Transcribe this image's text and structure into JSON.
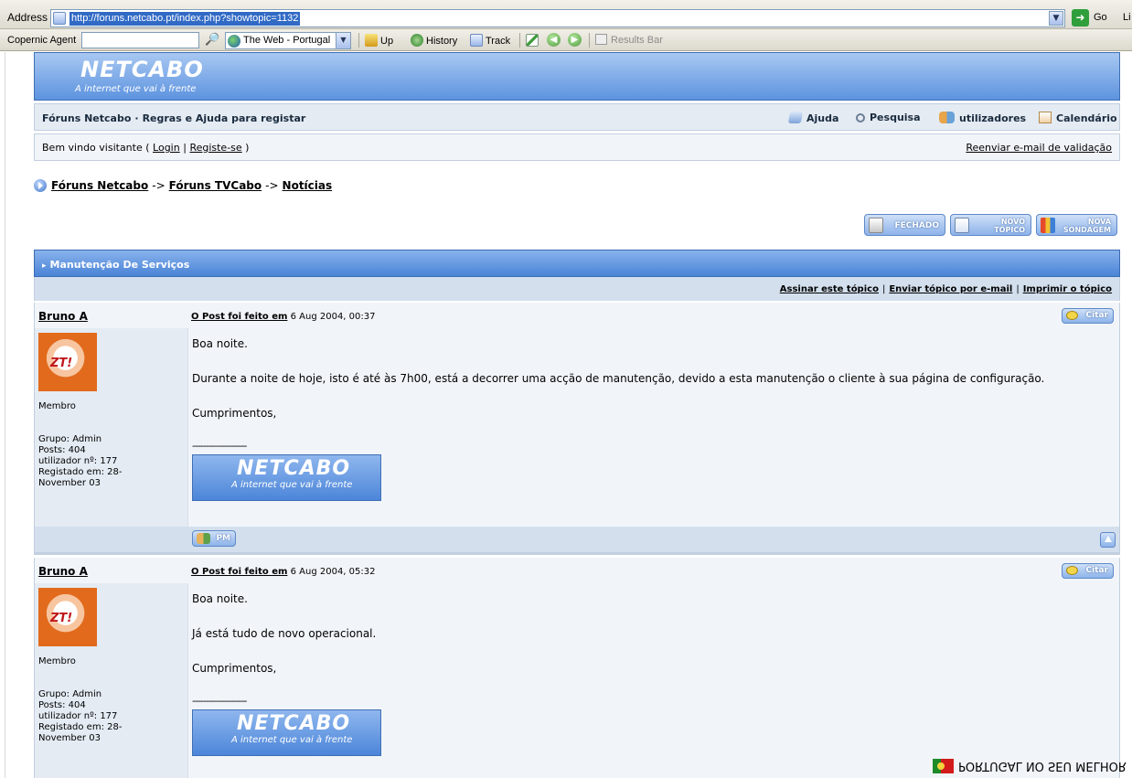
{
  "browser": {
    "address_label": "Address",
    "url": "http://foruns.netcabo.pt/index.php?showtopic=1132",
    "go_label": "Go",
    "links_label": "Li",
    "toolbar": {
      "agent_label": "Copernic Agent",
      "search_value": "",
      "search_scope": "The Web - Portugal",
      "up_label": "Up",
      "history_label": "History",
      "track_label": "Track",
      "results_bar_label": "Results Bar"
    }
  },
  "banner": {
    "logo": "NETCABO",
    "tagline": "A internet que vai à frente"
  },
  "nav": {
    "forum_name": "Fóruns Netcabo",
    "separator": "·",
    "rules": "Regras e Ajuda para registar",
    "help": "Ajuda",
    "search": "Pesquisa",
    "users": "utilizadores",
    "calendar": "Calendário"
  },
  "welcome": {
    "prefix": "Bem vindo visitante (",
    "login": "Login",
    "pipe": "|",
    "register": "Registe-se",
    "suffix": ")",
    "resend": "Reenviar e-mail de validação"
  },
  "breadcrumb": {
    "items": [
      "Fóruns Netcabo",
      "Fóruns TVCabo",
      "Notícias"
    ],
    "arrow": "->"
  },
  "actions": {
    "closed": "FECHADO",
    "new_topic_1": "NOVO",
    "new_topic_2": "TÓPICO",
    "new_poll_1": "NOVA",
    "new_poll_2": "SONDAGEM"
  },
  "topic": {
    "title": "Manutenção De Serviços",
    "subscribe": "Assinar este tópico",
    "email": "Enviar tópico por e-mail",
    "print": "Imprimir o tópico",
    "pipe": "|"
  },
  "posts": [
    {
      "author": "Bruno A",
      "posted_label": "O Post foi feito em",
      "date": "6 Aug 2004, 00:37",
      "cite": "Citar",
      "member": "Membro",
      "group": "Grupo: Admin",
      "posts": "Posts: 404",
      "user_no": "utilizador nº: 177",
      "registered_1": "Registado em: 28-",
      "registered_2": "November 03",
      "lines": [
        "Boa noite.",
        "Durante a noite de hoje, isto é até às 7h00, está a decorrer uma acção de manutenção, devido a esta manutenção o cliente à sua página de configuração.",
        "Cumprimentos,"
      ],
      "signature_line": "--------------------",
      "signature_logo": "NETCABO",
      "signature_tag": "A internet que vai à frente",
      "pm": "PM"
    },
    {
      "author": "Bruno A",
      "posted_label": "O Post foi feito em",
      "date": "6 Aug 2004, 05:32",
      "cite": "Citar",
      "member": "Membro",
      "group": "Grupo: Admin",
      "posts": "Posts: 404",
      "user_no": "utilizador nº: 177",
      "registered_1": "Registado em: 28-",
      "registered_2": "November 03",
      "lines": [
        "Boa noite.",
        "Já está tudo de novo operacional.",
        "Cumprimentos,"
      ],
      "signature_line": "--------------------",
      "signature_logo": "NETCABO",
      "signature_tag": "A internet que vai à frente"
    }
  ],
  "watermark": {
    "text": "PORTUGAL NO SEU MELHOR"
  },
  "colors": {
    "banner": "#5d93df",
    "nav_bg": "#e4ebf3",
    "post_bg": "#f1f5f9",
    "header_blue": "#4a84d7"
  }
}
